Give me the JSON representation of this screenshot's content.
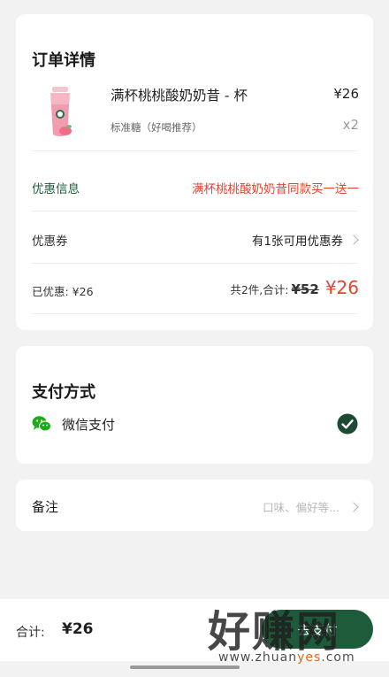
{
  "order": {
    "title": "订单详情",
    "product": {
      "name": "满杯桃桃酸奶奶昔 - 杯",
      "price": "¥26",
      "spec": "标准糖（好喝推荐）",
      "quantity": "x2"
    },
    "promotion": {
      "label": "优惠信息",
      "value": "满杯桃桃酸奶奶昔同款买一送一"
    },
    "coupon": {
      "label": "优惠券",
      "value": "有1张可用优惠券"
    },
    "summary": {
      "discount": "已优惠: ¥26",
      "count": "共2件,合计:",
      "original": "¥52",
      "total": "¥26"
    }
  },
  "payment": {
    "title": "支付方式",
    "method": "微信支付"
  },
  "note": {
    "label": "备注",
    "placeholder": "口味、偏好等..."
  },
  "bottom_bar": {
    "total_label": "合计:",
    "total_value": "¥26",
    "checkout_label": "去支付"
  },
  "watermark": {
    "logo": "好赚网",
    "url_prefix": "www.zhuan",
    "url_highlight": "yes",
    "url_suffix": ".com"
  },
  "colors": {
    "brand_green": "#1e5b3a",
    "price_red": "#e2452f",
    "wechat_green": "#1aad19"
  },
  "icons": [
    "product-drink-image",
    "chevron-right-icon",
    "wechat-icon",
    "check-circle-icon"
  ]
}
